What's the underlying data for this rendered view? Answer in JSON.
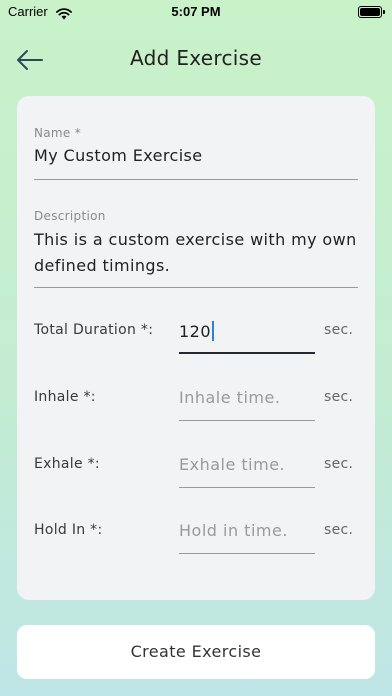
{
  "status_bar": {
    "carrier": "Carrier",
    "time": "5:07 PM"
  },
  "header": {
    "title": "Add Exercise",
    "back_icon": "arrow-left-icon"
  },
  "form": {
    "name": {
      "label": "Name *",
      "value": "My Custom Exercise"
    },
    "description": {
      "label": "Description",
      "value_line1": "This is a custom exercise with my own",
      "value_line2": "defined timings."
    },
    "total_duration": {
      "label": "Total Duration *:",
      "value": "120",
      "unit": "sec."
    },
    "inhale": {
      "label": "Inhale *:",
      "placeholder": "Inhale time.",
      "unit": "sec."
    },
    "exhale": {
      "label": "Exhale *:",
      "placeholder": "Exhale time.",
      "unit": "sec."
    },
    "hold_in": {
      "label": "Hold In *:",
      "placeholder": "Hold in time.",
      "unit": "sec."
    }
  },
  "actions": {
    "create_label": "Create Exercise"
  },
  "colors": {
    "background_top": "#c9f2c9",
    "background_bottom": "#bfe6e6",
    "card": "#f1f3f4",
    "caret": "#2f7de1",
    "focus_underline": "#1f2a33"
  }
}
